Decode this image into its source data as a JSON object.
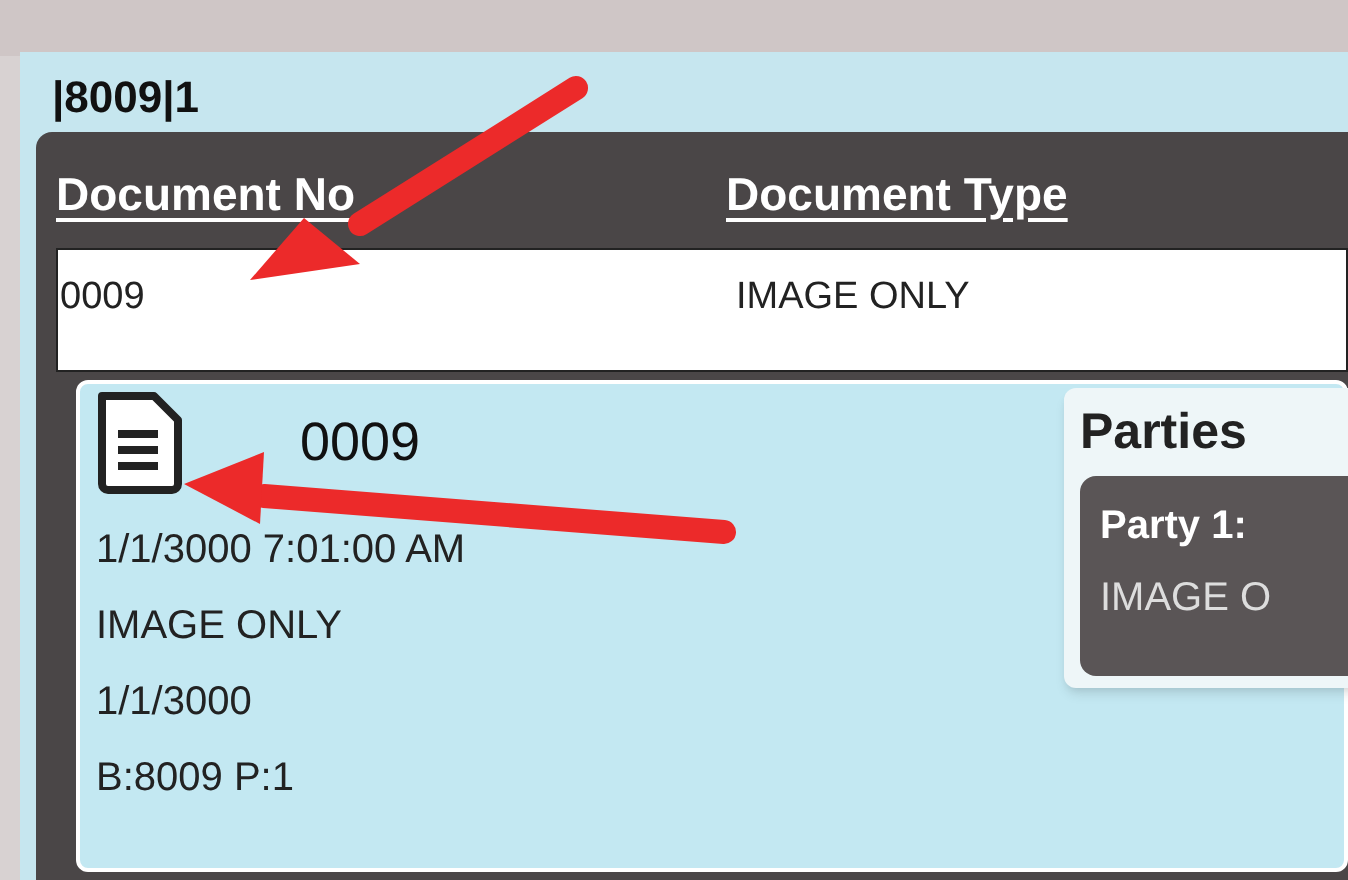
{
  "record_title": "|8009|1",
  "table": {
    "columns": [
      "Document No",
      "Document Type"
    ],
    "rows": [
      {
        "cells": [
          "0009",
          "IMAGE ONLY"
        ]
      }
    ]
  },
  "detail_card": {
    "title": "0009",
    "lines": [
      "1/1/3000 7:01:00 AM",
      "IMAGE ONLY",
      "1/1/3000",
      "B:8009 P:1"
    ]
  },
  "parties": {
    "title": "Parties",
    "items": [
      {
        "label": "Party 1:",
        "value": "IMAGE O"
      }
    ]
  }
}
